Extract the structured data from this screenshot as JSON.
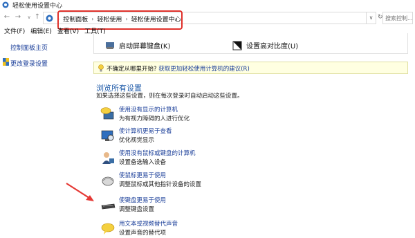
{
  "window": {
    "title": "轻松使用设置中心"
  },
  "address": {
    "crumbs": [
      "控制面板",
      "轻松使用",
      "轻松使用设置中心"
    ],
    "search_placeholder": "搜索控制..."
  },
  "menu": [
    "文件(F)",
    "编辑(E)",
    "查看(V)",
    "工具(T)"
  ],
  "sidebar": {
    "links": [
      "控制面板主页",
      "更改登录设置"
    ]
  },
  "top_items": [
    "启动屏幕键盘(K)",
    "设置高对比度(U)"
  ],
  "hint": {
    "prefix": "不确定从哪里开始?",
    "link": "获取更加轻松使用计算机的建议(R)"
  },
  "section": {
    "title": "浏览所有设置",
    "desc": "如果选择这些设置，则在每次登录时自动启动这些设置。"
  },
  "options": [
    {
      "title": "使用没有显示的计算机",
      "desc": "为有视力障碍的人进行优化"
    },
    {
      "title": "使计算机更易于查看",
      "desc": "优化视觉显示"
    },
    {
      "title": "使用没有鼠标或键盘的计算机",
      "desc": "设置备选输入设备"
    },
    {
      "title": "使鼠标更易于使用",
      "desc": "调整鼠标或其他指针设备的设置"
    },
    {
      "title": "使键盘更易于使用",
      "desc": "调整键盘设置"
    },
    {
      "title": "用文本或视频替代声音",
      "desc": "设置声音的替代项"
    }
  ],
  "colors": {
    "highlight": "#e0302a",
    "link": "#1a3e99",
    "section": "#1e5aa8",
    "arrow": "#e53935"
  }
}
